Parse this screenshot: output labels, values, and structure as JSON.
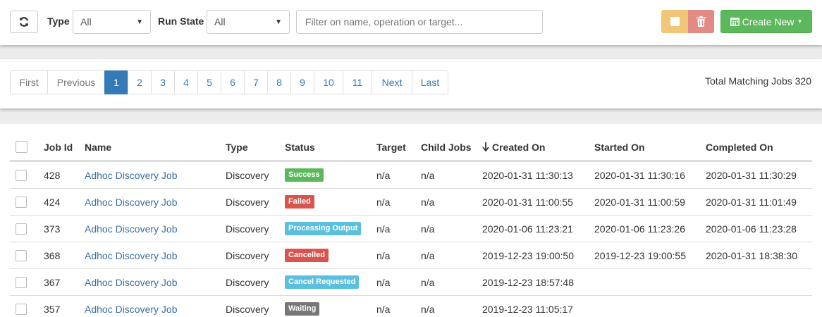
{
  "toolbar": {
    "refresh_icon": "refresh-icon",
    "type_label": "Type",
    "type_value": "All",
    "runstate_label": "Run State",
    "runstate_value": "All",
    "filter_placeholder": "Filter on name, operation or target...",
    "pause_icon": "pause-icon",
    "delete_icon": "trash-icon",
    "create_icon": "calendar-icon",
    "create_label": "Create New"
  },
  "colors": {
    "primary": "#337ab7",
    "success": "#5cb85c",
    "danger": "#d9534f",
    "info": "#5bc0de",
    "muted": "#777777",
    "warning_light": "#f0c678",
    "danger_light": "#e38a86"
  },
  "pagination": {
    "first": "First",
    "previous": "Previous",
    "pages": [
      "1",
      "2",
      "3",
      "4",
      "5",
      "6",
      "7",
      "8",
      "9",
      "10",
      "11"
    ],
    "active_page": "1",
    "next": "Next",
    "last": "Last",
    "total_label": "Total Matching Jobs 320"
  },
  "table": {
    "headers": {
      "job_id": "Job Id",
      "name": "Name",
      "type": "Type",
      "status": "Status",
      "target": "Target",
      "child_jobs": "Child Jobs",
      "sort_icon": "arrow-down-icon",
      "created_on": "Created On",
      "started_on": "Started On",
      "completed_on": "Completed On"
    },
    "rows": [
      {
        "job_id": "428",
        "name": "Adhoc Discovery Job",
        "type": "Discovery",
        "status": "Success",
        "status_color": "#5cb85c",
        "target": "n/a",
        "child_jobs": "n/a",
        "created_on": "2020-01-31 11:30:13",
        "started_on": "2020-01-31 11:30:16",
        "completed_on": "2020-01-31 11:30:29"
      },
      {
        "job_id": "424",
        "name": "Adhoc Discovery Job",
        "type": "Discovery",
        "status": "Failed",
        "status_color": "#d9534f",
        "target": "n/a",
        "child_jobs": "n/a",
        "created_on": "2020-01-31 11:00:55",
        "started_on": "2020-01-31 11:00:59",
        "completed_on": "2020-01-31 11:01:49"
      },
      {
        "job_id": "373",
        "name": "Adhoc Discovery Job",
        "type": "Discovery",
        "status": "Processing Output",
        "status_color": "#5bc0de",
        "target": "n/a",
        "child_jobs": "n/a",
        "created_on": "2020-01-06 11:23:21",
        "started_on": "2020-01-06 11:23:26",
        "completed_on": "2020-01-06 11:23:28"
      },
      {
        "job_id": "368",
        "name": "Adhoc Discovery Job",
        "type": "Discovery",
        "status": "Cancelled",
        "status_color": "#d9534f",
        "target": "n/a",
        "child_jobs": "n/a",
        "created_on": "2019-12-23 19:00:50",
        "started_on": "2019-12-23 19:00:55",
        "completed_on": "2020-01-31 18:38:30"
      },
      {
        "job_id": "367",
        "name": "Adhoc Discovery Job",
        "type": "Discovery",
        "status": "Cancel Requested",
        "status_color": "#5bc0de",
        "target": "n/a",
        "child_jobs": "n/a",
        "created_on": "2019-12-23 18:57:48",
        "started_on": "",
        "completed_on": ""
      },
      {
        "job_id": "357",
        "name": "Adhoc Discovery Job",
        "type": "Discovery",
        "status": "Waiting",
        "status_color": "#777777",
        "target": "n/a",
        "child_jobs": "n/a",
        "created_on": "2019-12-23 11:05:17",
        "started_on": "",
        "completed_on": ""
      }
    ]
  }
}
